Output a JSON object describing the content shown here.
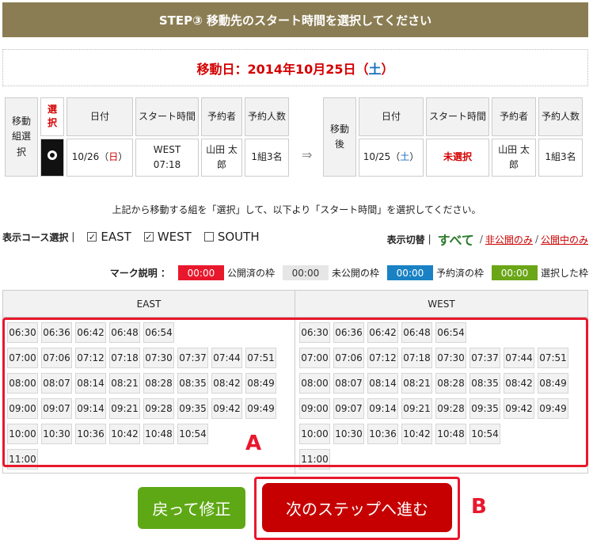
{
  "header": {
    "title": "STEP③ 移動先のスタート時間を選択してください"
  },
  "move_date": {
    "prefix": "移動日：2014年10月25日（",
    "weekday": "土",
    "suffix": "）"
  },
  "before_table": {
    "group_label": "移動組選択",
    "select_label": "選択",
    "headers": [
      "日付",
      "スタート時間",
      "予約者",
      "予約人数"
    ],
    "row": {
      "date_prefix": "10/26（",
      "weekday": "日",
      "date_suffix": "）",
      "start": "WEST 07:18",
      "reserver": "山田 太郎",
      "count": "1組3名"
    }
  },
  "arrow": "⇒",
  "after_table": {
    "label": "移動後",
    "headers": [
      "日付",
      "スタート時間",
      "予約者",
      "予約人数"
    ],
    "row": {
      "date_prefix": "10/25（",
      "weekday": "土",
      "date_suffix": "）",
      "start": "未選択",
      "reserver": "山田 太郎",
      "count": "1組3名"
    }
  },
  "instruction": "上記から移動する組を「選択」して、以下より「スタート時間」を選択してください。",
  "course_filter": {
    "label": "表示コース選択｜",
    "options": [
      {
        "name": "EAST",
        "checked": true
      },
      {
        "name": "WEST",
        "checked": true
      },
      {
        "name": "SOUTH",
        "checked": false
      }
    ]
  },
  "view_switch": {
    "label": "表示切替｜",
    "all": "すべて",
    "sep": "/",
    "private_only": "非公開のみ",
    "public_only": "公開中のみ"
  },
  "legend": {
    "label": "マーク説明 ：",
    "items": [
      {
        "time": "00:00",
        "text": "公開済の枠",
        "bg": "#e8182c",
        "fg": "#ffffff"
      },
      {
        "time": "00:00",
        "text": "未公開の枠",
        "bg": "#e6e6e6",
        "fg": "#333333"
      },
      {
        "time": "00:00",
        "text": "予約済の枠",
        "bg": "#1a82c4",
        "fg": "#ffffff"
      },
      {
        "time": "00:00",
        "text": "選択した枠",
        "bg": "#6aa617",
        "fg": "#ffffff"
      }
    ]
  },
  "courses": [
    {
      "name": "EAST",
      "rows": [
        [
          "06:30",
          "06:36",
          "06:42",
          "06:48",
          "06:54"
        ],
        [
          "07:00",
          "07:06",
          "07:12",
          "07:18",
          "07:30",
          "07:37",
          "07:44",
          "07:51"
        ],
        [
          "08:00",
          "08:07",
          "08:14",
          "08:21",
          "08:28",
          "08:35",
          "08:42",
          "08:49"
        ],
        [
          "09:00",
          "09:07",
          "09:14",
          "09:21",
          "09:28",
          "09:35",
          "09:42",
          "09:49"
        ],
        [
          "10:00",
          "10:30",
          "10:36",
          "10:42",
          "10:48",
          "10:54"
        ],
        [
          "11:00"
        ]
      ]
    },
    {
      "name": "WEST",
      "rows": [
        [
          "06:30",
          "06:36",
          "06:42",
          "06:48",
          "06:54"
        ],
        [
          "07:00",
          "07:06",
          "07:12",
          "07:18",
          "07:30",
          "07:37",
          "07:44",
          "07:51"
        ],
        [
          "08:00",
          "08:07",
          "08:14",
          "08:21",
          "08:28",
          "08:35",
          "08:42",
          "08:49"
        ],
        [
          "09:00",
          "09:07",
          "09:14",
          "09:21",
          "09:28",
          "09:35",
          "09:42",
          "09:49"
        ],
        [
          "10:00",
          "10:30",
          "10:36",
          "10:42",
          "10:48",
          "10:54"
        ],
        [
          "11:00"
        ]
      ]
    }
  ],
  "annotations": {
    "a": "A",
    "b": "B"
  },
  "buttons": {
    "back": "戻って修正",
    "next": "次のステップへ進む"
  }
}
